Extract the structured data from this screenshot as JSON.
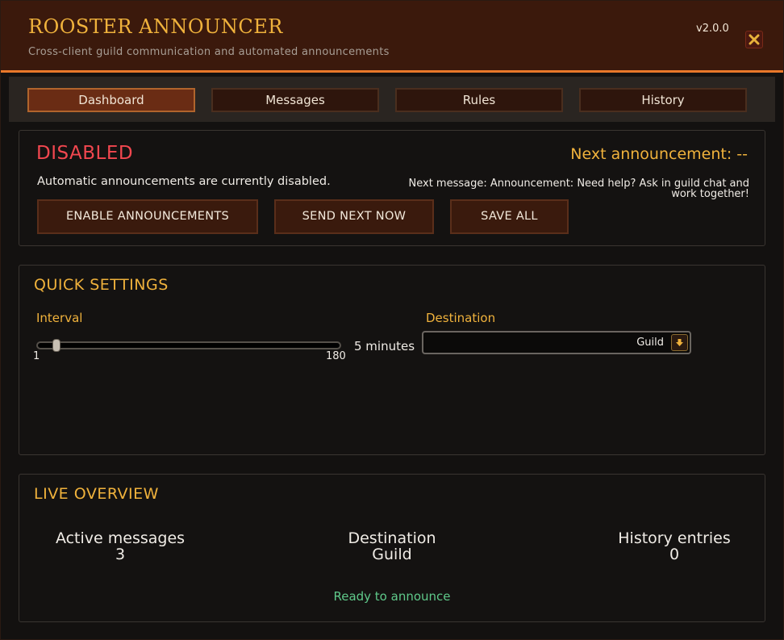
{
  "app": {
    "title": "ROOSTER ANNOUNCER",
    "subtitle": "Cross-client guild communication and automated announcements",
    "version": "v2.0.0"
  },
  "tabs": [
    {
      "label": "Dashboard",
      "active": true
    },
    {
      "label": "Messages",
      "active": false
    },
    {
      "label": "Rules",
      "active": false
    },
    {
      "label": "History",
      "active": false
    }
  ],
  "status": {
    "state": "DISABLED",
    "description": "Automatic announcements are currently disabled.",
    "next_announcement": "Next announcement: --",
    "next_message": "Next message: Announcement: Need help? Ask in guild chat and work together!"
  },
  "actions": {
    "enable": "ENABLE ANNOUNCEMENTS",
    "send_next": "SEND NEXT NOW",
    "save_all": "SAVE ALL"
  },
  "quick_settings": {
    "title": "QUICK SETTINGS",
    "interval_label": "Interval",
    "interval_min": "1",
    "interval_max": "180",
    "interval_value": 5,
    "interval_display": "5 minutes",
    "destination_label": "Destination",
    "destination_value": "Guild"
  },
  "live_overview": {
    "title": "LIVE OVERVIEW",
    "stats": [
      {
        "label": "Active messages",
        "value": "3"
      },
      {
        "label": "Destination",
        "value": "Guild"
      },
      {
        "label": "History entries",
        "value": "0"
      }
    ],
    "status_text": "Ready to announce"
  },
  "colors": {
    "accent": "#f0b23c",
    "disabled": "#f2474f",
    "ready": "#5fc98a",
    "header_bg": "#3b190c",
    "header_rule": "#e8782a"
  },
  "icons": {
    "close": "close-icon",
    "dropdown": "arrow-down-icon"
  }
}
